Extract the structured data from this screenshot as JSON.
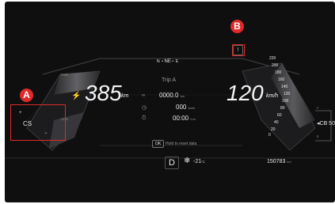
{
  "compass": {
    "left": "N",
    "dir": "NE",
    "right": "E"
  },
  "trip": {
    "label": "Trip A",
    "distance": "0000.0",
    "distance_unit": "km",
    "avg_speed": "000",
    "avg_speed_unit": "km/h",
    "time": "00:00",
    "time_unit": "h:m"
  },
  "range": {
    "value": "385",
    "unit": "km"
  },
  "speed": {
    "value": "120",
    "unit": "km/h"
  },
  "left_gauge": {
    "top_label": "PWR",
    "bottom_label": "CHG",
    "mode": "CS",
    "plus": "+",
    "minus": "−"
  },
  "speed_ticks": [
    "220",
    "200",
    "180",
    "160",
    "140",
    "120",
    "100",
    "80",
    "60",
    "40",
    "20",
    "0"
  ],
  "ok_hint": {
    "button": "OK",
    "text": "Hold to reset data"
  },
  "gear": "D",
  "temperature": {
    "value": "-21",
    "unit": "°C"
  },
  "odometer": {
    "value": "150783",
    "unit": "km"
  },
  "right_cluster": {
    "label": "CB 50",
    "top": "F",
    "bottom": "E"
  },
  "markers": {
    "a": "A",
    "b": "B"
  },
  "colors": {
    "marker": "#e02a2a",
    "screen": "#0f0f10"
  }
}
